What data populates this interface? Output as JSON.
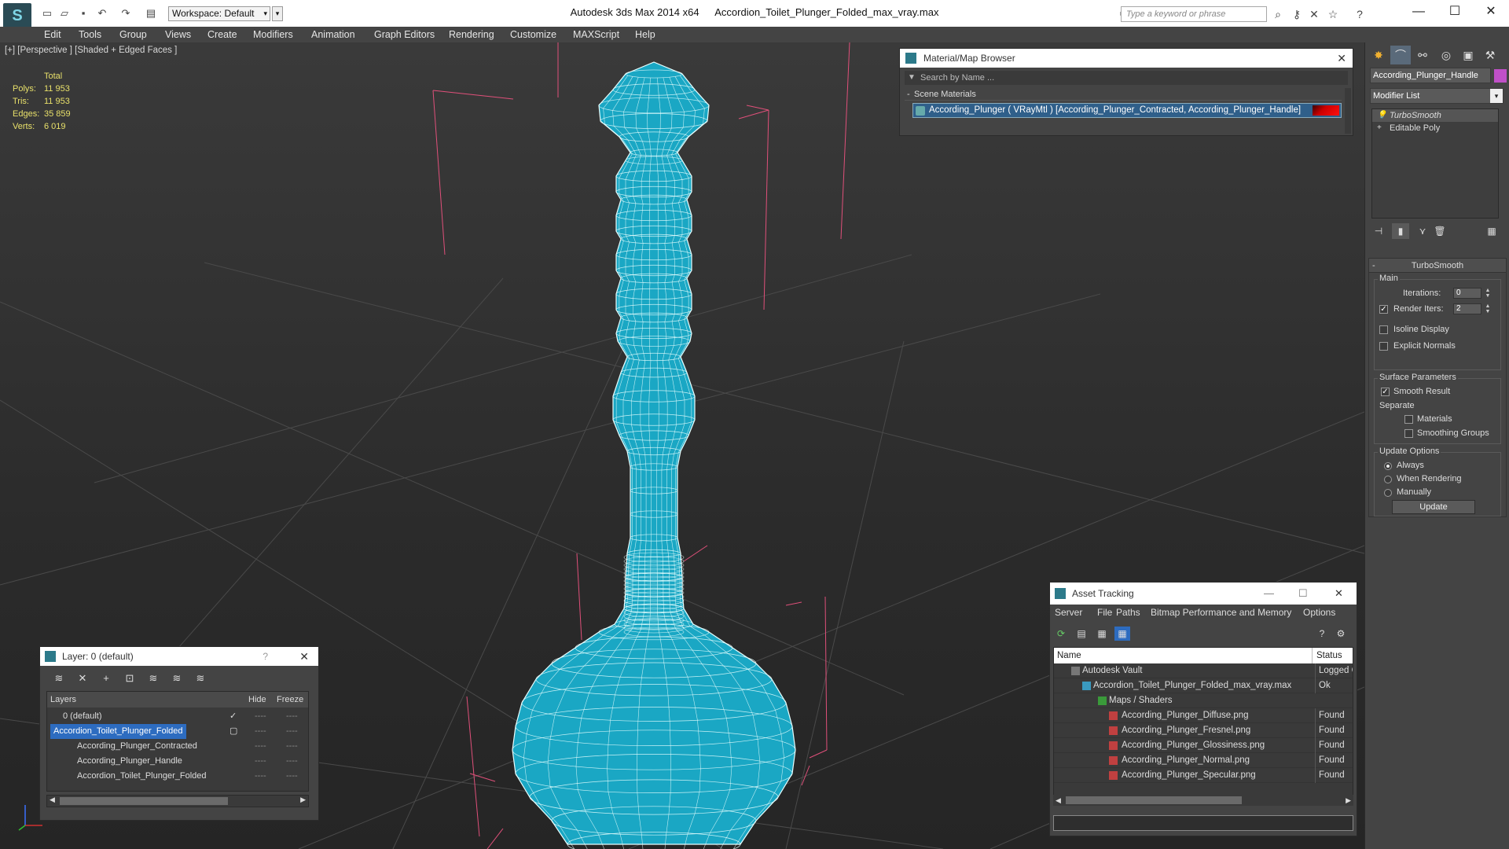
{
  "titlebar": {
    "workspace": "Workspace: Default",
    "app_title": "Autodesk 3ds Max  2014 x64",
    "file_title": "Accordion_Toilet_Plunger_Folded_max_vray.max",
    "search_placeholder": "Type a keyword or phrase",
    "window_controls": [
      "minimize-icon",
      "maximize-icon",
      "close-icon"
    ]
  },
  "menu": [
    "Edit",
    "Tools",
    "Group",
    "Views",
    "Create",
    "Modifiers",
    "Animation",
    "Graph Editors",
    "Rendering",
    "Customize",
    "MAXScript",
    "Help"
  ],
  "viewport": {
    "label": "[+] [Perspective ] [Shaded + Edged Faces ]",
    "stats_header": "Total",
    "stats": [
      {
        "label": "Polys:",
        "value": "11 953"
      },
      {
        "label": "Tris:",
        "value": "11 953"
      },
      {
        "label": "Edges:",
        "value": "35 859"
      },
      {
        "label": "Verts:",
        "value": "6 019"
      }
    ],
    "mesh_color": "#1aa7c4",
    "wire_color": "#e8ffff",
    "bbox_color": "#e0507a"
  },
  "command_panel": {
    "object_name": "According_Plunger_Handle",
    "object_color": "#c050c8",
    "modifier_list": "Modifier List",
    "stack": [
      "TurboSmooth",
      "Editable Poly"
    ],
    "rollout_title": "TurboSmooth",
    "main_label": "Main",
    "iterations_label": "Iterations:",
    "iterations_value": "0",
    "render_iters_label": "Render Iters:",
    "render_iters_value": "2",
    "isoline_label": "Isoline Display",
    "explicit_normals_label": "Explicit Normals",
    "surface_params_label": "Surface Parameters",
    "smooth_result_label": "Smooth Result",
    "separate_label": "Separate",
    "materials_label": "Materials",
    "smoothing_groups_label": "Smoothing Groups",
    "update_options_label": "Update Options",
    "always_label": "Always",
    "when_rendering_label": "When Rendering",
    "manually_label": "Manually",
    "update_button": "Update"
  },
  "material_browser": {
    "title": "Material/Map Browser",
    "search_placeholder": "Search by Name ...",
    "section": "Scene Materials",
    "item": "According_Plunger  ( VRayMtl ) [According_Plunger_Contracted, According_Plunger_Handle]"
  },
  "layer_window": {
    "title": "Layer: 0 (default)",
    "help": "?",
    "col_layers": "Layers",
    "col_hide": "Hide",
    "col_freeze": "Freeze",
    "rows": [
      {
        "name": "0 (default)",
        "indent": 0,
        "selected": false,
        "checked": true
      },
      {
        "name": "Accordion_Toilet_Plunger_Folded",
        "indent": 0,
        "selected": true,
        "checked": false
      },
      {
        "name": "According_Plunger_Contracted",
        "indent": 1,
        "selected": false,
        "checked": false
      },
      {
        "name": "According_Plunger_Handle",
        "indent": 1,
        "selected": false,
        "checked": false
      },
      {
        "name": "Accordion_Toilet_Plunger_Folded",
        "indent": 1,
        "selected": false,
        "checked": false
      }
    ],
    "dash": "----"
  },
  "asset_tracking": {
    "title": "Asset Tracking",
    "menu": [
      "Server",
      "File",
      "Paths",
      "Bitmap Performance and Memory",
      "Options"
    ],
    "col_name": "Name",
    "col_status": "Status",
    "rows": [
      {
        "name": "Autodesk Vault",
        "status": "Logged Out",
        "indent": 1
      },
      {
        "name": "Accordion_Toilet_Plunger_Folded_max_vray.max",
        "status": "Ok",
        "indent": 2
      },
      {
        "name": "Maps / Shaders",
        "status": "",
        "indent": 3
      },
      {
        "name": "According_Plunger_Diffuse.png",
        "status": "Found",
        "indent": 4
      },
      {
        "name": "According_Plunger_Fresnel.png",
        "status": "Found",
        "indent": 4
      },
      {
        "name": "According_Plunger_Glossiness.png",
        "status": "Found",
        "indent": 4
      },
      {
        "name": "According_Plunger_Normal.png",
        "status": "Found",
        "indent": 4
      },
      {
        "name": "According_Plunger_Specular.png",
        "status": "Found",
        "indent": 4
      }
    ]
  }
}
